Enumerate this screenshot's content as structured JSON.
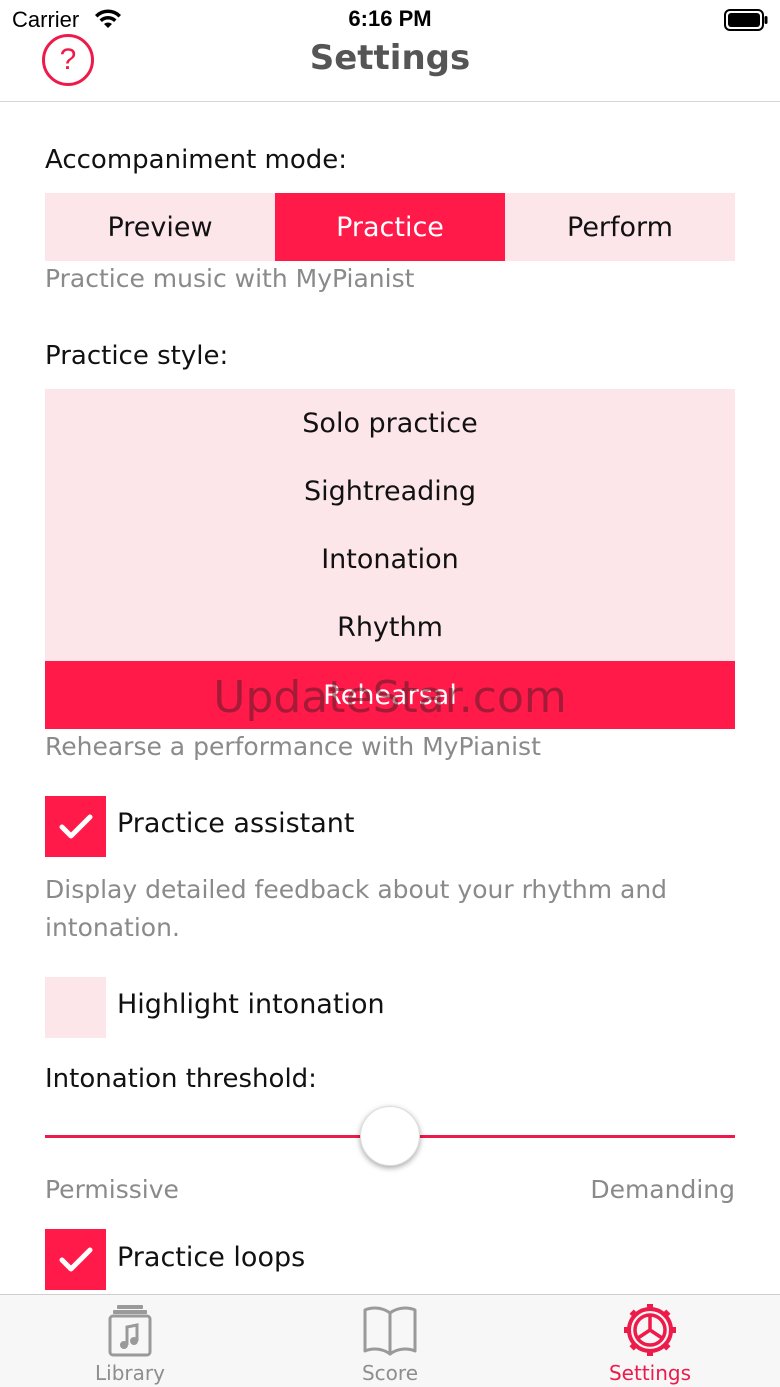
{
  "status_bar": {
    "carrier": "Carrier",
    "time": "6:16 PM"
  },
  "nav": {
    "title": "Settings",
    "help_symbol": "?"
  },
  "accompaniment": {
    "label": "Accompaniment mode:",
    "options": [
      "Preview",
      "Practice",
      "Perform"
    ],
    "selected": "Practice",
    "description": "Practice music with MyPianist"
  },
  "practice_style": {
    "label": "Practice style:",
    "options": [
      "Solo practice",
      "Sightreading",
      "Intonation",
      "Rhythm",
      "Rehearsal"
    ],
    "selected": "Rehearsal",
    "description": "Rehearse a performance with MyPianist"
  },
  "practice_assistant": {
    "label": "Practice assistant",
    "checked": true,
    "description_line1": "Display detailed feedback about your rhythm and",
    "description_line2": "intonation."
  },
  "highlight_intonation": {
    "label": "Highlight intonation",
    "checked": false
  },
  "intonation_threshold": {
    "label": "Intonation threshold:",
    "value": 0.5,
    "min_label": "Permissive",
    "max_label": "Demanding"
  },
  "practice_loops": {
    "label": "Practice loops",
    "checked": true
  },
  "tabs": [
    {
      "label": "Library",
      "icon": "library-icon",
      "active": false
    },
    {
      "label": "Score",
      "icon": "score-book-icon",
      "active": false
    },
    {
      "label": "Settings",
      "icon": "settings-gear-icon",
      "active": true
    }
  ],
  "watermark": "UpdateStar.com",
  "colors": {
    "accent": "#ff1a4a",
    "inactive_fill": "#fde6ea",
    "hint_text": "#8a8a8a"
  }
}
